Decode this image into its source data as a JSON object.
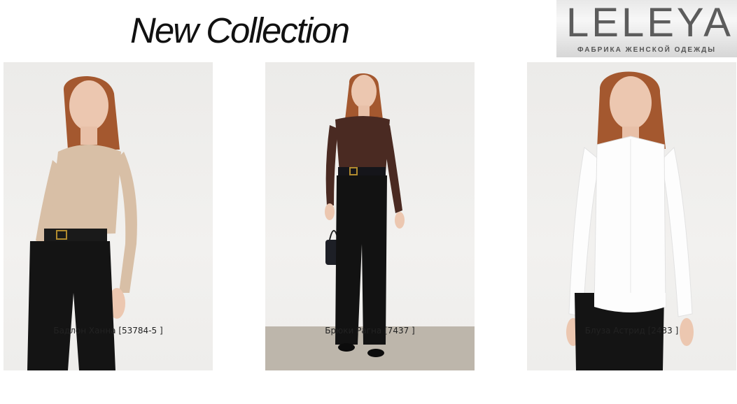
{
  "header": {
    "title": "New Collection",
    "logo": {
      "mark": "LELEYA",
      "tagline": "ФАБРИКА ЖЕНСКОЙ ОДЕЖДЫ"
    }
  },
  "products": [
    {
      "caption": "Бадлон Ханна [53784-5 ]",
      "top_color": "#d8bfa6",
      "bottom_color": "#141414"
    },
    {
      "caption": "Брюки Рагна [7437 ]",
      "top_color": "#4a2a22",
      "bottom_color": "#121212"
    },
    {
      "caption": "Блуза Астрид [2433 ]",
      "top_color": "#fdfdfd",
      "bottom_color": "#141414"
    }
  ],
  "colors": {
    "background": "#ffffff",
    "text": "#222222",
    "logo_text": "#5c5c5c"
  }
}
